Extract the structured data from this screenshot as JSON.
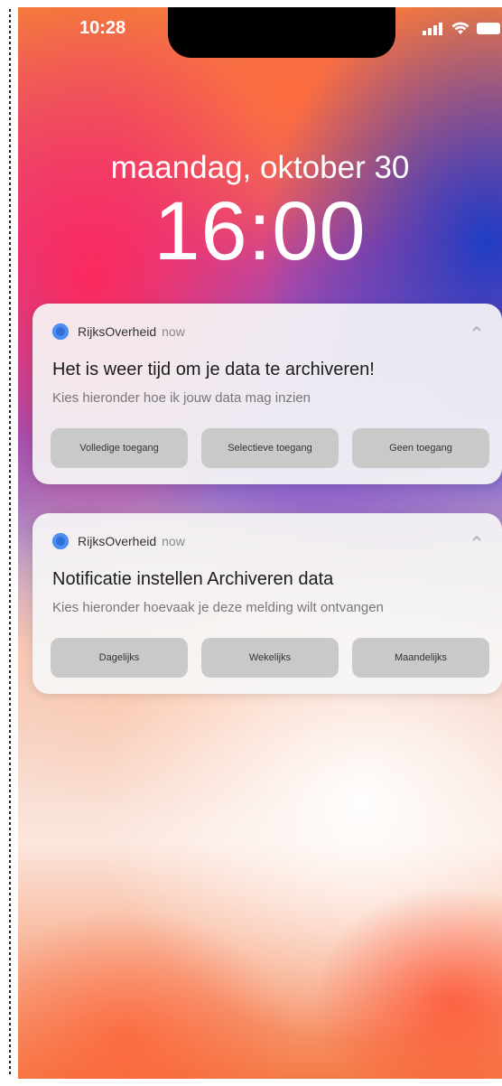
{
  "status_bar": {
    "time": "10:28",
    "signal_icon": "signal-bars-icon",
    "wifi_icon": "wifi-icon",
    "battery_icon": "battery-icon"
  },
  "lock_screen": {
    "date": "maandag, oktober 30",
    "time": "16:00"
  },
  "notifications": [
    {
      "app_name": "RijksOverheid",
      "time": "now",
      "title": "Het is weer tijd om je data te archiveren!",
      "body": "Kies hieronder hoe ik jouw data mag inzien",
      "actions": [
        "Volledige toegang",
        "Selectieve toegang",
        "Geen toegang"
      ]
    },
    {
      "app_name": "RijksOverheid",
      "time": "now",
      "title": "Notificatie instellen  Archiveren data",
      "body": "Kies hieronder hoevaak je deze melding wilt ontvangen",
      "actions": [
        "Dagelijks",
        "Wekelijks",
        "Maandelijks"
      ]
    }
  ],
  "colors": {
    "app_icon": "#2f6fd6",
    "card_bg": "#f6f6f6",
    "button_bg": "#c9c9c9"
  }
}
